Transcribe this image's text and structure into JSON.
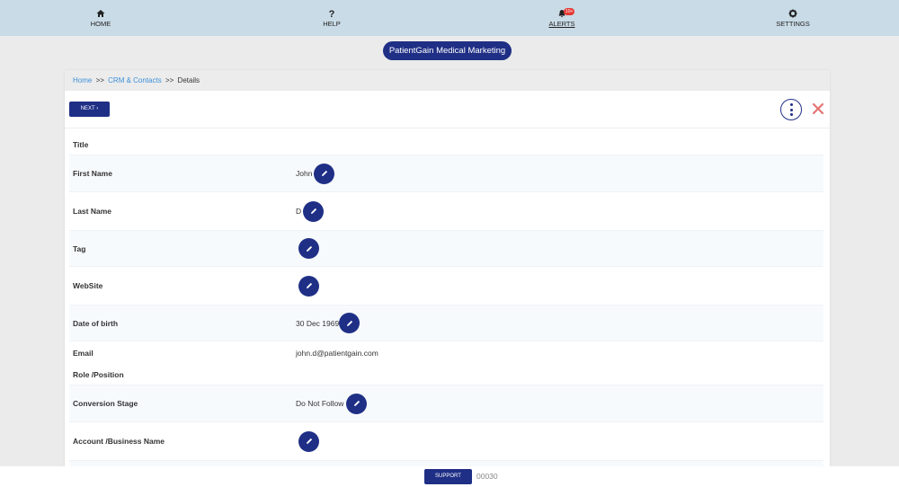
{
  "nav": {
    "home": {
      "label": "HOME",
      "icon": "home-icon"
    },
    "help": {
      "label": "HELP",
      "icon": "question-icon"
    },
    "alerts": {
      "label": "ALERTS",
      "icon": "bell-icon",
      "badge": "10+"
    },
    "settings": {
      "label": "SETTINGS",
      "icon": "gear-icon"
    }
  },
  "brand": "PatientGain Medical Marketing",
  "breadcrumb": {
    "home": "Home",
    "sep": ">>",
    "crm": "CRM & Contacts",
    "current": "Details"
  },
  "toolbar": {
    "next_label": "NEXT ›"
  },
  "fields": [
    {
      "label": "Title",
      "value": ""
    },
    {
      "label": "First Name",
      "value": "John"
    },
    {
      "label": "Last Name",
      "value": "D"
    },
    {
      "label": "Tag",
      "value": ""
    },
    {
      "label": "WebSite",
      "value": ""
    },
    {
      "label": "Date of birth",
      "value": "30 Dec 1969"
    },
    {
      "label": "Email",
      "value": "john.d@patientgain.com"
    },
    {
      "label": "Role /Position",
      "value": ""
    },
    {
      "label": "Conversion Stage",
      "value": "Do Not Follow"
    },
    {
      "label": "Account /Business Name",
      "value": ""
    }
  ],
  "footer": {
    "support_label": "SUPPORT",
    "code": "00030"
  },
  "colors": {
    "primary": "#1f2f86",
    "link": "#3b8fd9",
    "close": "#e57373",
    "nav_bg": "#c9dbe6"
  }
}
